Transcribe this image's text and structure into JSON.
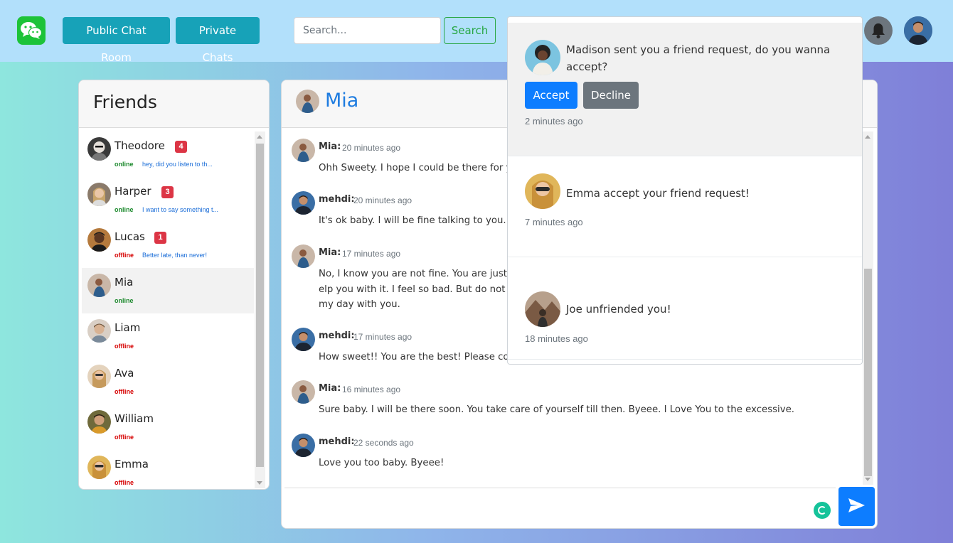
{
  "navbar": {
    "logo_icon": "wechat-chat-bubbles-icon",
    "public_chat_label": "Public Chat Room",
    "private_chats_label": "Private Chats",
    "search_placeholder": "Search...",
    "search_button_label": "Search",
    "bell_icon": "bell-icon"
  },
  "friends": {
    "title": "Friends",
    "items": [
      {
        "name": "Theodore",
        "badge": "4",
        "status": "online",
        "preview": "hey, did you listen to th..."
      },
      {
        "name": "Harper",
        "badge": "3",
        "status": "online",
        "preview": "I want to say something t..."
      },
      {
        "name": "Lucas",
        "badge": "1",
        "status": "offline",
        "preview": "Better late, than never!"
      },
      {
        "name": "Mia",
        "badge": "",
        "status": "online",
        "preview": ""
      },
      {
        "name": "Liam",
        "badge": "",
        "status": "offline",
        "preview": ""
      },
      {
        "name": "Ava",
        "badge": "",
        "status": "offline",
        "preview": ""
      },
      {
        "name": "William",
        "badge": "",
        "status": "offline",
        "preview": ""
      },
      {
        "name": "Emma",
        "badge": "",
        "status": "offline",
        "preview": ""
      }
    ]
  },
  "chat": {
    "title": "Mia",
    "messages": [
      {
        "author": "Mia:",
        "time": "20 minutes ago",
        "text": [
          "Ohh Sweety. I hope I could be there for you"
        ]
      },
      {
        "author": "mehdi:",
        "time": "20 minutes ago",
        "text": [
          "It's ok baby. I will be fine talking to you."
        ]
      },
      {
        "author": "Mia:",
        "time": "17 minutes ago",
        "text": [
          "No, I know you are not fine. You are just tr",
          "elp you with it. I feel so bad. But do not wo",
          "my day with you."
        ]
      },
      {
        "author": "mehdi:",
        "time": "17 minutes ago",
        "text": [
          "How sweet!! You are the best! Please come"
        ]
      },
      {
        "author": "Mia:",
        "time": "16 minutes ago",
        "text": [
          "Sure baby. I will be there soon. You take care of yourself till then. Byeee. I Love You to the excessive."
        ]
      },
      {
        "author": "mehdi:",
        "time": "22 seconds ago",
        "text": [
          "Love you too baby. Byeee!"
        ]
      }
    ],
    "send_icon": "send-icon"
  },
  "notifications": [
    {
      "text": "Madison sent you a friend request, do you wanna accept?",
      "accept_label": "Accept",
      "decline_label": "Decline",
      "time": "2 minutes ago"
    },
    {
      "text": "Emma accept your friend request!",
      "time": "7 minutes ago"
    },
    {
      "text": "Joe unfriended you!",
      "time": "18 minutes ago"
    }
  ],
  "colors": {
    "navbar_bg": "#b2e0fb",
    "teal_button": "#17a2b8",
    "primary_blue": "#0d7dff",
    "badge_red": "#dc3545",
    "online_green": "#1d8a2e",
    "offline_red": "#d60000"
  }
}
